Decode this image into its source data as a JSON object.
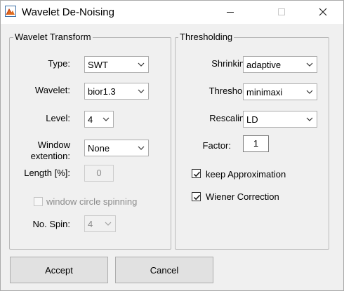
{
  "window": {
    "title": "Wavelet De-Noising",
    "app_icon": "matlab-figure-icon",
    "controls": [
      "minimize-icon",
      "maximize-icon",
      "close-icon"
    ]
  },
  "wavelet_transform": {
    "group_label": "Wavelet Transform",
    "type": {
      "label": "Type:",
      "value": "SWT"
    },
    "wavelet": {
      "label": "Wavelet:",
      "value": "bior1.3"
    },
    "level": {
      "label": "Level:",
      "value": "4"
    },
    "window_extension": {
      "label_line1": "Window",
      "label_line2": "extention:",
      "value": "None"
    },
    "length": {
      "label": "Length [%]:",
      "value": "0",
      "enabled": false
    },
    "window_circle_spinning": {
      "label": "window circle spinning",
      "checked": false,
      "enabled": false
    },
    "no_spin": {
      "label": "No. Spin:",
      "value": "4",
      "enabled": false
    }
  },
  "thresholding": {
    "group_label": "Thresholding",
    "shrinking": {
      "label": "Shrinking:",
      "value": "adaptive"
    },
    "threshold": {
      "label": "Threshold:",
      "value": "minimaxi"
    },
    "rescaling": {
      "label": "Rescaling:",
      "value": "LD"
    },
    "factor": {
      "label": "Factor:",
      "value": "1"
    },
    "keep_approximation": {
      "label": "keep Approximation",
      "checked": true
    },
    "wiener_correction": {
      "label": "Wiener Correction",
      "checked": true
    }
  },
  "buttons": {
    "accept": "Accept",
    "cancel": "Cancel"
  }
}
